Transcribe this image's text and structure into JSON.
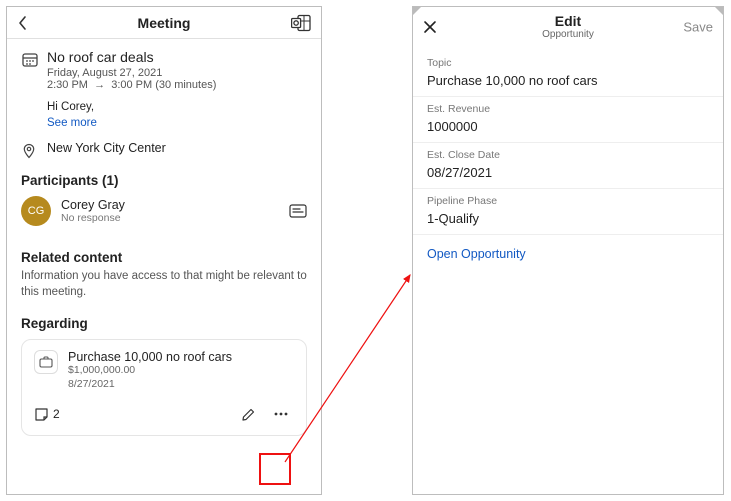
{
  "left": {
    "header_title": "Meeting",
    "meeting": {
      "title": "No roof car deals",
      "date": "Friday, August 27, 2021",
      "start": "2:30 PM",
      "end": "3:00 PM",
      "duration": "(30 minutes)",
      "greeting": "Hi Corey,",
      "see_more": "See more",
      "location": "New York City Center"
    },
    "participants_heading": "Participants (1)",
    "participant": {
      "initials": "CG",
      "name": "Corey Gray",
      "response": "No response"
    },
    "related_heading": "Related content",
    "related_desc": "Information you have access to that might be relevant to this meeting.",
    "regarding_heading": "Regarding",
    "card": {
      "title": "Purchase 10,000 no roof cars",
      "revenue": "$1,000,000.00",
      "date": "8/27/2021",
      "note_count": "2"
    }
  },
  "right": {
    "header_title": "Edit",
    "header_sub": "Opportunity",
    "save": "Save",
    "fields": {
      "topic_label": "Topic",
      "topic_value": "Purchase 10,000 no roof cars",
      "rev_label": "Est. Revenue",
      "rev_value": "1000000",
      "close_label": "Est. Close Date",
      "close_value": "08/27/2021",
      "phase_label": "Pipeline Phase",
      "phase_value": "1-Qualify"
    },
    "open_link": "Open Opportunity"
  }
}
